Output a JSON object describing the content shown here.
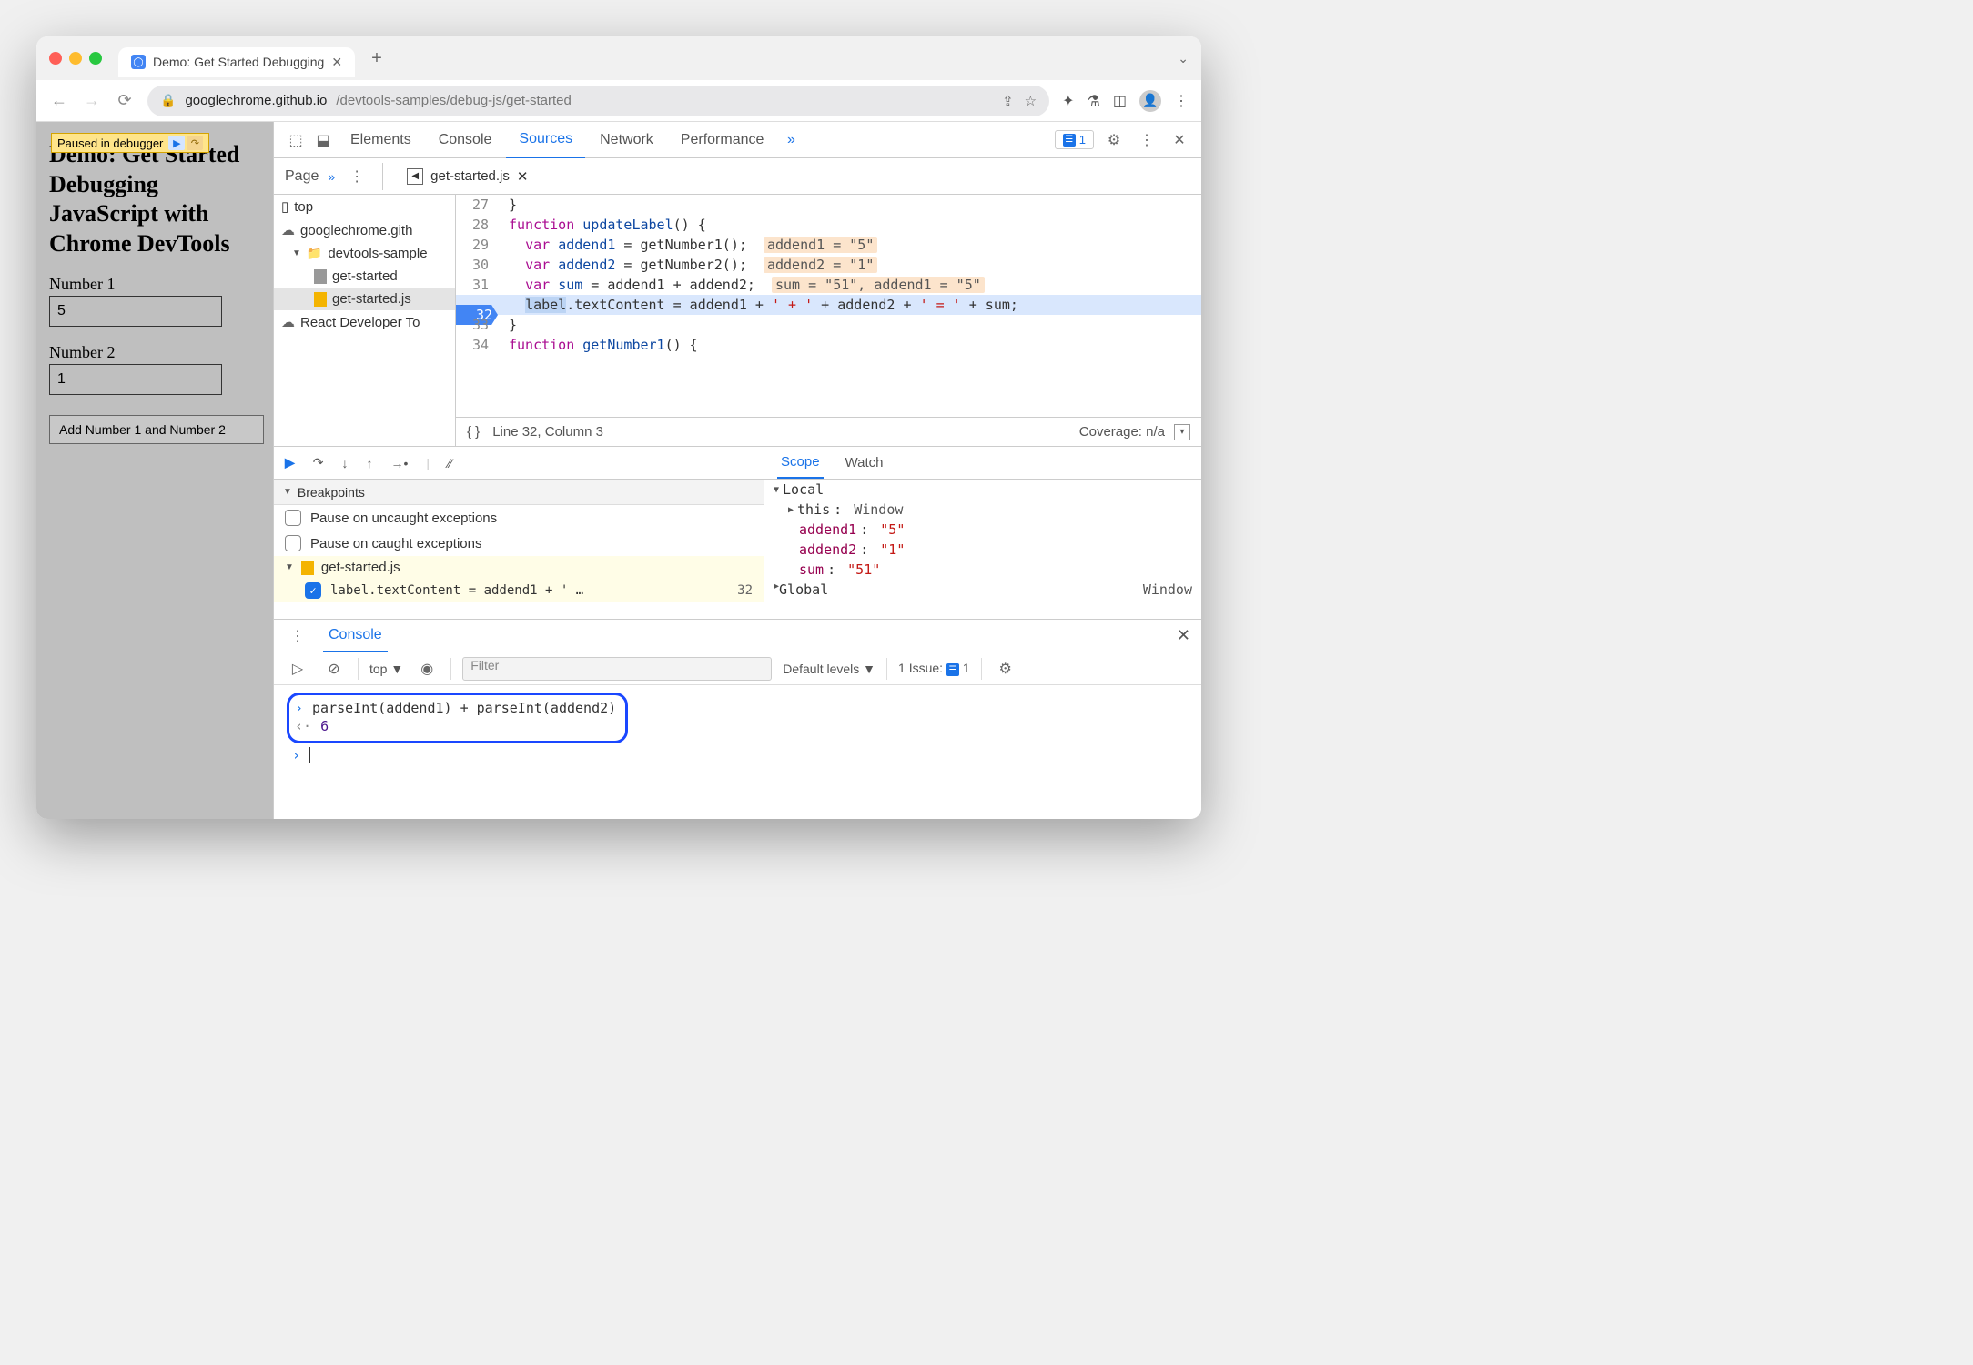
{
  "browser": {
    "tab_title": "Demo: Get Started Debugging",
    "url_host": "googlechrome.github.io",
    "url_path": "/devtools-samples/debug-js/get-started"
  },
  "overlay": {
    "paused_text": "Paused in debugger"
  },
  "page": {
    "heading": "Demo: Get Started Debugging JavaScript with Chrome DevTools",
    "label1": "Number 1",
    "value1": "5",
    "label2": "Number 2",
    "value2": "1",
    "button": "Add Number 1 and Number 2"
  },
  "devtools": {
    "tabs": [
      "Elements",
      "Console",
      "Sources",
      "Network",
      "Performance"
    ],
    "active_tab": "Sources",
    "issue_count": "1",
    "sources": {
      "nav_tab": "Page",
      "open_file": "get-started.js",
      "tree": {
        "top": "top",
        "origin": "googlechrome.gith",
        "folder": "devtools-sample",
        "file_html": "get-started",
        "file_js": "get-started.js",
        "ext": "React Developer To"
      },
      "status": {
        "pos": "Line 32, Column 3",
        "coverage": "Coverage: n/a"
      }
    },
    "code": {
      "lines": [
        {
          "n": 27,
          "raw": "}"
        },
        {
          "n": 28,
          "kw": "function",
          "name": "updateLabel",
          "rest": "() {"
        },
        {
          "n": 29,
          "kw": "var",
          "id": "addend1",
          "rest": " = getNumber1();",
          "inline": "addend1 = \"5\""
        },
        {
          "n": 30,
          "kw": "var",
          "id": "addend2",
          "rest": " = getNumber2();",
          "inline": "addend2 = \"1\""
        },
        {
          "n": 31,
          "kw": "var",
          "id": "sum",
          "rest": " = addend1 + addend2;",
          "inline": "sum = \"51\", addend1 = \"5\""
        },
        {
          "n": 32,
          "token": "label",
          "rest_a": ".textContent = addend1 + ",
          "str1": "' + '",
          "mid": " + addend2 + ",
          "str2": "' = '",
          "rest_b": " + sum;"
        },
        {
          "n": 33,
          "raw": "}"
        },
        {
          "n": 34,
          "kw": "function",
          "name": "getNumber1",
          "rest": "() {"
        }
      ]
    },
    "breakpoints": {
      "header": "Breakpoints",
      "pause_uncaught": "Pause on uncaught exceptions",
      "pause_caught": "Pause on caught exceptions",
      "file": "get-started.js",
      "bp_text": "label.textContent = addend1 + ' …",
      "bp_line": "32"
    },
    "scope": {
      "tabs": [
        "Scope",
        "Watch"
      ],
      "local_label": "Local",
      "this_label": "this",
      "this_value": "Window",
      "vars": [
        {
          "name": "addend1",
          "value": "\"5\""
        },
        {
          "name": "addend2",
          "value": "\"1\""
        },
        {
          "name": "sum",
          "value": "\"51\""
        }
      ],
      "global_label": "Global",
      "global_value": "Window"
    },
    "console": {
      "label": "Console",
      "context": "top",
      "filter_placeholder": "Filter",
      "levels": "Default levels",
      "issue_text": "1 Issue:",
      "issue_count": "1",
      "input": "parseInt(addend1) + parseInt(addend2)",
      "output": "6"
    }
  }
}
